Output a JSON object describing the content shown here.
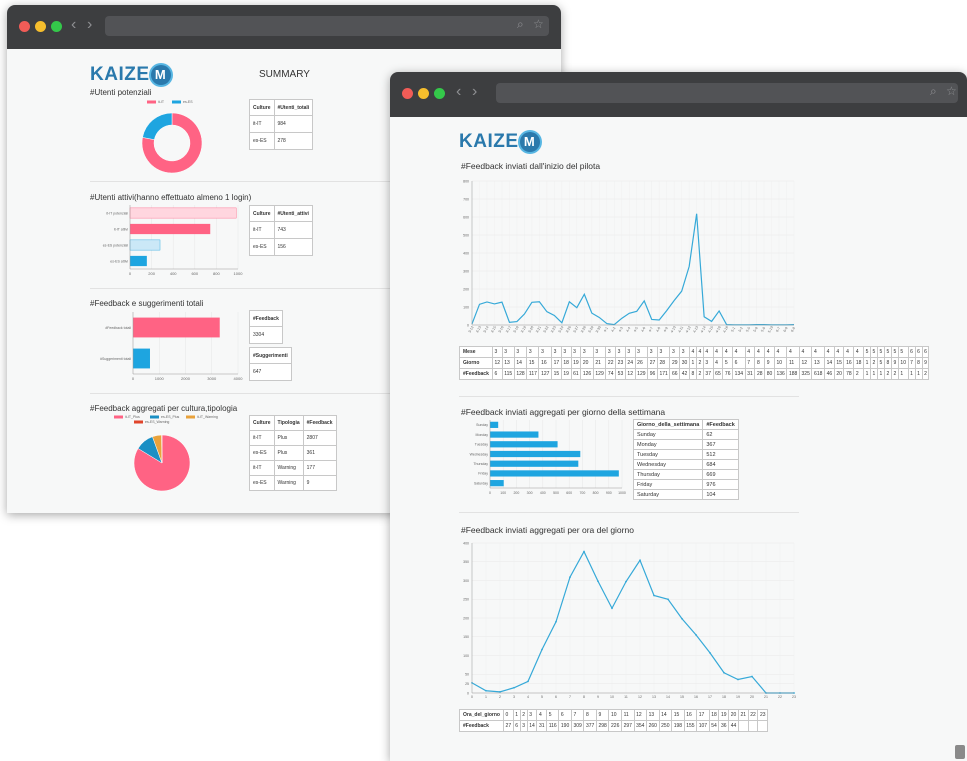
{
  "window1": {
    "logo": {
      "text": "KAIZE",
      "m": "M"
    },
    "summary_title": "SUMMARY",
    "sections": {
      "utenti_potenziali": {
        "title": "#Utenti potenziali",
        "table": {
          "headers": [
            "Culture",
            "#Utenti_totali"
          ],
          "rows": [
            [
              "it-IT",
              "984"
            ],
            [
              "es-ES",
              "278"
            ]
          ]
        },
        "chart_data": {
          "type": "pie",
          "categories": [
            "it-IT",
            "es-ES"
          ],
          "values": [
            984,
            278
          ],
          "colors": [
            "#ff6384",
            "#1ea5e0"
          ],
          "donut": true,
          "legend": "top"
        }
      },
      "utenti_attivi": {
        "title": "#Utenti attivi(hanno effettuato almeno 1 login)",
        "table": {
          "headers": [
            "Culture",
            "#Utenti_attivi"
          ],
          "rows": [
            [
              "it-IT",
              "743"
            ],
            [
              "es-ES",
              "156"
            ]
          ]
        },
        "chart_data": {
          "type": "bar",
          "orientation": "horizontal",
          "categories": [
            "it-IT potenziali",
            "it-IT attivi",
            "es-ES potenziali",
            "es-ES attivi"
          ],
          "values": [
            984,
            743,
            278,
            156
          ],
          "colors": [
            "#ffd6df",
            "#ff6384",
            "#cbe8f7",
            "#1ea5e0"
          ],
          "xlim": [
            0,
            1000
          ],
          "xticks": [
            "0",
            "200",
            "400",
            "600",
            "800",
            "1000"
          ]
        }
      },
      "feedback_totali": {
        "title": "#Feedback e suggerimenti totali",
        "table_feedback": {
          "headers": [
            "#Feedback"
          ],
          "rows": [
            [
              "3304"
            ]
          ]
        },
        "table_suggerimenti": {
          "headers": [
            "#Suggerimenti"
          ],
          "rows": [
            [
              "647"
            ]
          ]
        },
        "chart_data": {
          "type": "bar",
          "orientation": "horizontal",
          "categories": [
            "#Feedback totali",
            "#Suggerimenti totali"
          ],
          "values": [
            3304,
            647
          ],
          "colors": [
            "#ff6384",
            "#1ea5e0"
          ],
          "xlim": [
            0,
            4000
          ],
          "xticks": [
            "0",
            "1000",
            "2000",
            "3000",
            "4000"
          ]
        }
      },
      "feedback_aggregati": {
        "title": "#Feedback aggregati per cultura,tipologia",
        "table": {
          "headers": [
            "Culture",
            "Tipologia",
            "#Feedback"
          ],
          "rows": [
            [
              "it-IT",
              "Plus",
              "2807"
            ],
            [
              "es-ES",
              "Plus",
              "361"
            ],
            [
              "it-IT",
              "Warning",
              "177"
            ],
            [
              "es-ES",
              "Warning",
              "9"
            ]
          ]
        },
        "chart_data": {
          "type": "pie",
          "categories": [
            "it-IT_Plus",
            "es-ES_Plus",
            "it-IT_Warning",
            "es-ES_Warning"
          ],
          "values": [
            2807,
            361,
            177,
            9
          ],
          "colors": [
            "#ff6384",
            "#1a8fc4",
            "#e9a23b",
            "#e0452b"
          ],
          "legend": "top"
        }
      }
    }
  },
  "window2": {
    "logo": {
      "text": "KAIZE",
      "m": "M"
    },
    "sections": {
      "pilota": {
        "title": "#Feedback inviati dall'inizio del pilota",
        "chart_data": {
          "type": "line",
          "color": "#36a9d8",
          "ylim": [
            0,
            800
          ],
          "yticks": [
            "0",
            "100",
            "200",
            "300",
            "400",
            "500",
            "600",
            "700",
            "800"
          ],
          "x": [
            "3-12",
            "3-13",
            "3-14",
            "3-15",
            "3-16",
            "3-17",
            "3-18",
            "3-19",
            "3-20",
            "3-21",
            "3-22",
            "3-23",
            "3-24",
            "3-26",
            "3-27",
            "3-28",
            "3-29",
            "3-30",
            "4-1",
            "4-2",
            "4-3",
            "4-4",
            "4-5",
            "4-6",
            "4-7",
            "4-8",
            "4-9",
            "4-10",
            "4-11",
            "4-12",
            "4-13",
            "4-14",
            "4-15",
            "4-16",
            "4-18",
            "5-1",
            "5-2",
            "5-5",
            "5-8",
            "5-9",
            "5-10",
            "6-7",
            "6-8",
            "6-9"
          ],
          "values": [
            6,
            115,
            128,
            117,
            127,
            15,
            19,
            61,
            126,
            129,
            74,
            53,
            12,
            129,
            96,
            171,
            66,
            42,
            8,
            2,
            37,
            65,
            76,
            134,
            31,
            28,
            80,
            136,
            188,
            325,
            618,
            46,
            20,
            78,
            2,
            1,
            1,
            1,
            2,
            2,
            1,
            1,
            1,
            2
          ]
        },
        "table": {
          "row_labels": [
            "Mese",
            "Giorno",
            "#Feedback"
          ],
          "mese": [
            "3",
            "3",
            "3",
            "3",
            "3",
            "3",
            "3",
            "3",
            "3",
            "3",
            "3",
            "3",
            "3",
            "3",
            "3",
            "3",
            "3",
            "3",
            "4",
            "4",
            "4",
            "4",
            "4",
            "4",
            "4",
            "4",
            "4",
            "4",
            "4",
            "4",
            "4",
            "4",
            "4",
            "4",
            "4",
            "5",
            "5",
            "5",
            "5",
            "5",
            "5",
            "6",
            "6",
            "6"
          ],
          "giorno": [
            "12",
            "13",
            "14",
            "15",
            "16",
            "17",
            "18",
            "19",
            "20",
            "21",
            "22",
            "23",
            "24",
            "26",
            "27",
            "28",
            "29",
            "30",
            "1",
            "2",
            "3",
            "4",
            "5",
            "6",
            "7",
            "8",
            "9",
            "10",
            "11",
            "12",
            "13",
            "14",
            "15",
            "16",
            "18",
            "1",
            "2",
            "5",
            "8",
            "9",
            "10",
            "7",
            "8",
            "9"
          ],
          "feedback": [
            "6",
            "115",
            "128",
            "117",
            "127",
            "15",
            "19",
            "61",
            "126",
            "129",
            "74",
            "53",
            "12",
            "129",
            "96",
            "171",
            "66",
            "42",
            "8",
            "2",
            "37",
            "65",
            "76",
            "134",
            "31",
            "28",
            "80",
            "136",
            "188",
            "325",
            "618",
            "46",
            "20",
            "78",
            "2",
            "1",
            "1",
            "1",
            "2",
            "2",
            "1",
            "1",
            "1",
            "2"
          ]
        }
      },
      "settimana": {
        "title": "#Feedback inviati aggregati per giorno della settimana",
        "chart_data": {
          "type": "bar",
          "orientation": "horizontal",
          "color": "#1ea5e0",
          "categories": [
            "Sunday",
            "Monday",
            "Tuesday",
            "Wednesday",
            "Thursday",
            "Friday",
            "Saturday"
          ],
          "values": [
            62,
            367,
            512,
            684,
            669,
            976,
            104
          ],
          "xlim": [
            0,
            1000
          ],
          "xticks": [
            "0",
            "100",
            "200",
            "300",
            "400",
            "500",
            "600",
            "700",
            "800",
            "900",
            "1000"
          ]
        },
        "table": {
          "headers": [
            "Giorno_della_settimana",
            "#Feedback"
          ],
          "rows": [
            [
              "Sunday",
              "62"
            ],
            [
              "Monday",
              "367"
            ],
            [
              "Tuesday",
              "512"
            ],
            [
              "Wednesday",
              "684"
            ],
            [
              "Thursday",
              "669"
            ],
            [
              "Friday",
              "976"
            ],
            [
              "Saturday",
              "104"
            ]
          ]
        }
      },
      "ora": {
        "title": "#Feedback inviati aggregati per ora del giorno",
        "chart_data": {
          "type": "line",
          "color": "#36a9d8",
          "x": [
            0,
            1,
            2,
            3,
            4,
            5,
            6,
            7,
            8,
            9,
            10,
            11,
            12,
            13,
            14,
            15,
            16,
            17,
            18,
            19,
            20,
            21,
            22,
            23
          ],
          "values": [
            27,
            6,
            3,
            14,
            31,
            116,
            190,
            309,
            377,
            298,
            226,
            297,
            354,
            260,
            250,
            198,
            155,
            107,
            54,
            36,
            44,
            0,
            0,
            0
          ],
          "ylim": [
            0,
            400
          ],
          "yticks": [
            "0",
            "25",
            "50",
            "100",
            "150",
            "200",
            "250",
            "300",
            "350",
            "400"
          ]
        },
        "table": {
          "row_labels": [
            "Ora_del_giorno",
            "#Feedback"
          ],
          "ore": [
            "0",
            "1",
            "2",
            "3",
            "4",
            "5",
            "6",
            "7",
            "8",
            "9",
            "10",
            "11",
            "12",
            "13",
            "14",
            "15",
            "16",
            "17",
            "18",
            "19",
            "20",
            "21",
            "22",
            "23"
          ],
          "feedback": [
            "27",
            "6",
            "3",
            "14",
            "31",
            "116",
            "190",
            "309",
            "377",
            "298",
            "226",
            "297",
            "354",
            "260",
            "250",
            "198",
            "155",
            "107",
            "54",
            "36",
            "44",
            "",
            "",
            ""
          ]
        }
      }
    }
  }
}
